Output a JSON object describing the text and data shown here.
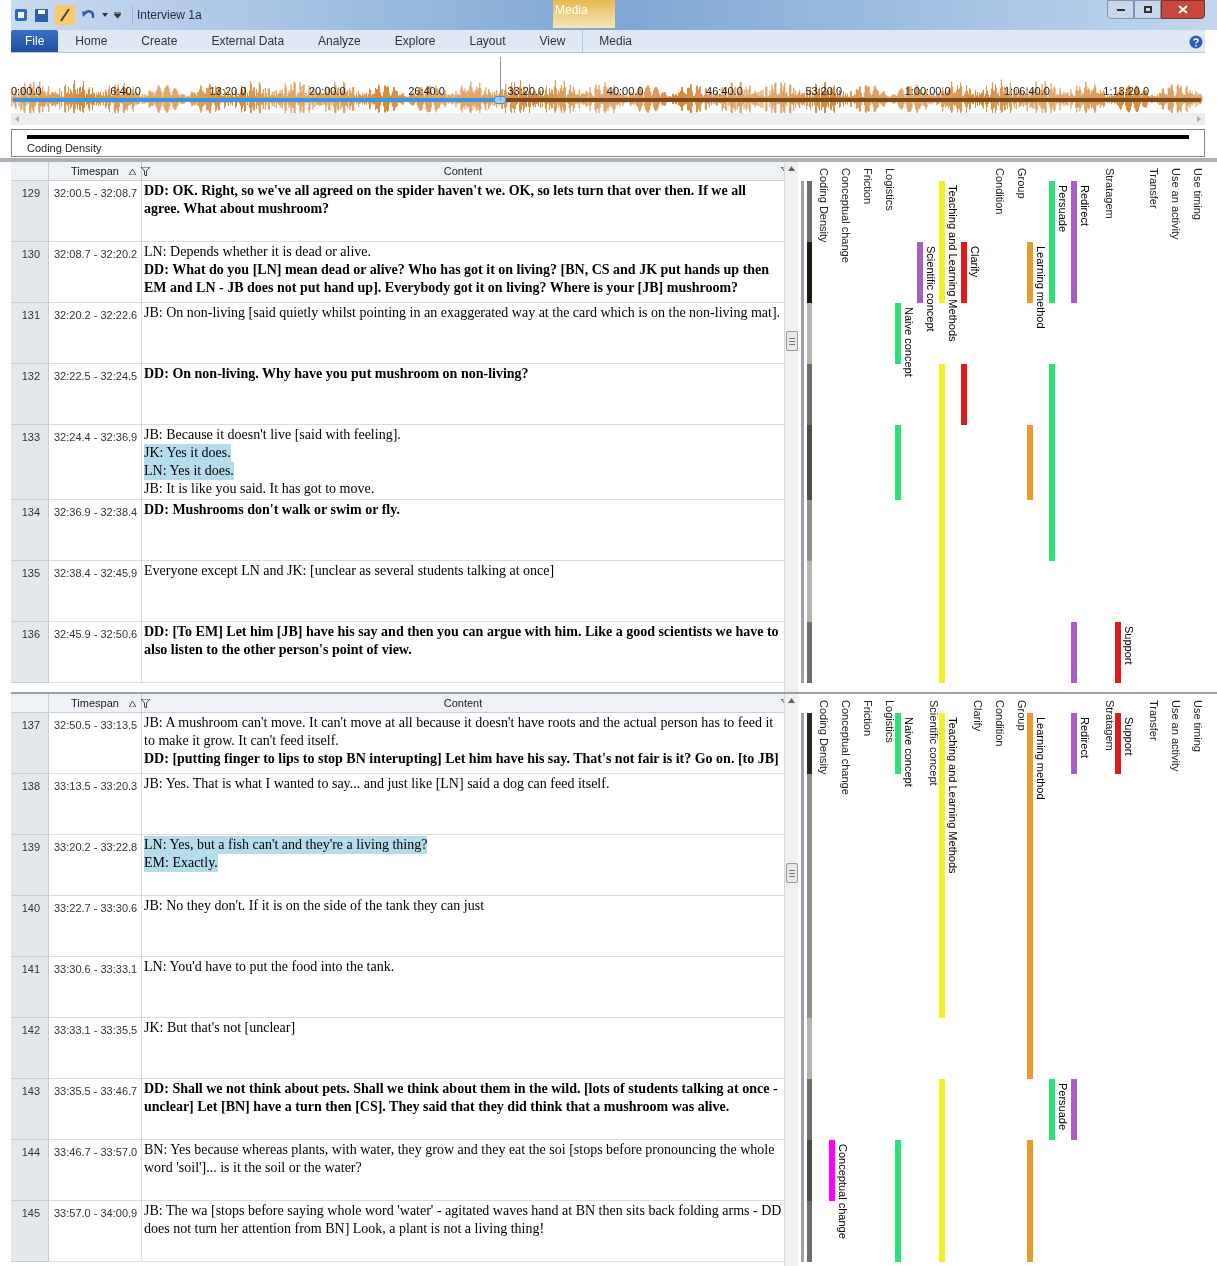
{
  "window": {
    "title": "Interview 1a",
    "context_group": "Media"
  },
  "ribbon_tabs": [
    {
      "label": "File",
      "kind": "file"
    },
    {
      "label": "Home",
      "kind": "tab"
    },
    {
      "label": "Create",
      "kind": "tab"
    },
    {
      "label": "External Data",
      "kind": "tab"
    },
    {
      "label": "Analyze",
      "kind": "tab"
    },
    {
      "label": "Explore",
      "kind": "tab"
    },
    {
      "label": "Layout",
      "kind": "tab"
    },
    {
      "label": "View",
      "kind": "tab"
    },
    {
      "label": "Media",
      "kind": "context"
    }
  ],
  "media": {
    "level": 0.41,
    "time_labels": [
      "0:00.0",
      "6:40.0",
      "13:20.0",
      "20:00.0",
      "26:40.0",
      "33:20.0",
      "40:00.0",
      "46:40.0",
      "53:20.0",
      "1:00:00.0",
      "1:06:40.0",
      "1:13:20.0"
    ]
  },
  "coding_density_strip": {
    "label": "Coding Density"
  },
  "panes": [
    {
      "columns": {
        "timespan": "Timespan",
        "content": "Content"
      },
      "rows": [
        {
          "number": "129",
          "timespan": "32:00.5 - 32:08.7",
          "lines": [
            {
              "text": "DD: OK. Right, so we've all agreed on the spider haven't we. OK, so lets turn that over then. If we all agree. What about mushroom?",
              "bold": true,
              "highlighted": false
            }
          ]
        },
        {
          "number": "130",
          "timespan": "32:08.7 - 32:20.2",
          "lines": [
            {
              "text": "LN: Depends whether it is dead or alive.",
              "bold": false,
              "highlighted": false
            },
            {
              "text": "DD: What do you [LN] mean dead or alive? Who has got it on living? [BN, CS and JK put hands up then EM and LN - JB does not put hand up]. Everybody got it on living? Where is your [JB] mushroom?",
              "bold": true,
              "highlighted": false
            }
          ]
        },
        {
          "number": "131",
          "timespan": "32:20.2 - 32:22.6",
          "lines": [
            {
              "text": "JB: On non-living [said quietly whilst pointing in an exaggerated way at the card which is on the non-living mat].",
              "bold": false,
              "highlighted": false
            }
          ]
        },
        {
          "number": "132",
          "timespan": "32:22.5 - 32:24.5",
          "lines": [
            {
              "text": "DD: On non-living. Why have you put mushroom on non-living?",
              "bold": true,
              "highlighted": false
            }
          ]
        },
        {
          "number": "133",
          "timespan": "32:24.4 - 32:36.9",
          "lines": [
            {
              "text": "JB: Because it doesn't live [said with feeling].",
              "bold": false,
              "highlighted": false
            },
            {
              "text": "JK: Yes it does.",
              "bold": false,
              "highlighted": true
            },
            {
              "text": "LN: Yes it does.",
              "bold": false,
              "highlighted": true
            },
            {
              "text": "JB: It is like you said. It has got to move.",
              "bold": false,
              "highlighted": false
            }
          ]
        },
        {
          "number": "134",
          "timespan": "32:36.9 - 32:38.4",
          "lines": [
            {
              "text": "DD: Mushrooms don't walk or swim or fly.",
              "bold": true,
              "highlighted": false
            }
          ]
        },
        {
          "number": "135",
          "timespan": "32:38.4 - 32:45.9",
          "lines": [
            {
              "text": "Everyone except LN and JK: [unclear as several students talking at once]",
              "bold": false,
              "highlighted": false
            }
          ]
        },
        {
          "number": "136",
          "timespan": "32:45.9 - 32:50.6",
          "lines": [
            {
              "text": "DD: [To EM] Let him [JB] have his say and then you can argue with him. Like a good scientists we have to also listen to the other person's point of view.",
              "bold": true,
              "highlighted": false
            }
          ]
        }
      ],
      "stripes": [
        {
          "kind": "density",
          "name": "Coding Density"
        },
        {
          "kind": "code",
          "name": "Conceptual change"
        },
        {
          "kind": "code",
          "name": "Friction"
        },
        {
          "kind": "code",
          "name": "Logistics"
        },
        {
          "kind": "code",
          "bar_label": "Naive concept",
          "color": "#2ee07a",
          "coded": [
            false,
            false,
            true,
            false,
            true,
            false,
            false,
            false
          ]
        },
        {
          "kind": "code",
          "bar_label": "Scientific concept",
          "color": "#a85ec4",
          "coded": [
            false,
            true,
            false,
            false,
            false,
            false,
            false,
            false
          ]
        },
        {
          "kind": "code",
          "bar_label": "Teaching and Learning Methods",
          "color": "#f2f222",
          "coded": [
            true,
            true,
            false,
            true,
            true,
            true,
            true,
            true
          ]
        },
        {
          "kind": "code",
          "bar_label": "Clarify",
          "color": "#e01a1a",
          "coded": [
            false,
            true,
            false,
            true,
            false,
            false,
            false,
            false
          ]
        },
        {
          "kind": "code",
          "name": "Condition"
        },
        {
          "kind": "code",
          "name": "Group"
        },
        {
          "kind": "code",
          "bar_label": "Learning method",
          "color": "#e89a2c",
          "coded": [
            false,
            true,
            false,
            false,
            true,
            false,
            false,
            false
          ]
        },
        {
          "kind": "code",
          "bar_label": "Persuade",
          "color": "#2ee07a",
          "coded": [
            true,
            true,
            false,
            true,
            true,
            true,
            false,
            false
          ]
        },
        {
          "kind": "code",
          "bar_label": "Redirect",
          "color": "#a85ec4",
          "coded": [
            true,
            true,
            false,
            false,
            false,
            false,
            false,
            true
          ]
        },
        {
          "kind": "code",
          "name": "Stratagem"
        },
        {
          "kind": "code",
          "bar_label": "Support",
          "color": "#e01a1a",
          "coded": [
            false,
            false,
            false,
            false,
            false,
            false,
            false,
            true
          ]
        },
        {
          "kind": "code",
          "name": "Transfer"
        },
        {
          "kind": "code",
          "name": "Use an activity"
        },
        {
          "kind": "code",
          "name": "Use timing"
        }
      ]
    },
    {
      "columns": {
        "timespan": "Timespan",
        "content": "Content"
      },
      "rows": [
        {
          "number": "137",
          "timespan": "32:50.5 - 33:13.5",
          "lines": [
            {
              "text": "JB: A mushroom can't move. It can't move at all because it doesn't have roots and the actual person has to feed it to make it grow. It can't feed itself.",
              "bold": false,
              "highlighted": false
            },
            {
              "text": "DD: [putting finger to lips to stop BN interupting] Let him have his say. That's not fair is it? Go on. [to JB]",
              "bold": true,
              "highlighted": false
            }
          ]
        },
        {
          "number": "138",
          "timespan": "33:13.5 - 33:20.3",
          "lines": [
            {
              "text": "JB: Yes. That is what I wanted to say... and just like [LN] said a dog can feed itself.",
              "bold": false,
              "highlighted": false
            }
          ]
        },
        {
          "number": "139",
          "timespan": "33:20.2 - 33:22.8",
          "lines": [
            {
              "text": "LN: Yes, but a fish can't and they're a living thing?",
              "bold": false,
              "highlighted": true
            },
            {
              "text": "EM: Exactly.",
              "bold": false,
              "highlighted": true
            }
          ]
        },
        {
          "number": "140",
          "timespan": "33:22.7 - 33:30.6",
          "lines": [
            {
              "text": "JB: No they don't. If it is on the side of the tank they can just",
              "bold": false,
              "highlighted": false
            }
          ]
        },
        {
          "number": "141",
          "timespan": "33:30.6 - 33:33.1",
          "lines": [
            {
              "text": "LN: You'd have to put the food into the tank.",
              "bold": false,
              "highlighted": false
            }
          ]
        },
        {
          "number": "142",
          "timespan": "33:33.1 - 33:35.5",
          "lines": [
            {
              "text": "JK: But that's not [unclear]",
              "bold": false,
              "highlighted": false
            }
          ]
        },
        {
          "number": "143",
          "timespan": "33:35.5 - 33:46.7",
          "lines": [
            {
              "text": "DD: Shall we not think about pets. Shall we think about them in the wild. [lots of students talking at once - unclear] Let [BN] have a turn then [CS]. They said that they did think that a mushroom was alive.",
              "bold": true,
              "highlighted": false
            }
          ]
        },
        {
          "number": "144",
          "timespan": "33:46.7 - 33:57.0",
          "lines": [
            {
              "text": "BN: Yes because whereas plants, with water, they grow and they eat the soi [stops before pronouncing the whole word 'soil']... is it the soil or the water?",
              "bold": false,
              "highlighted": false
            }
          ]
        },
        {
          "number": "145",
          "timespan": "33:57.0 - 34:00.9",
          "lines": [
            {
              "text": "JB: The wa [stops before saying whole word 'water' - agitated waves hand at BN then sits back folding arms - DD does not turn her attention from BN] Look, a plant is not a living thing!",
              "bold": false,
              "highlighted": false
            }
          ]
        }
      ],
      "stripes": [
        {
          "kind": "density",
          "name": "Coding Density"
        },
        {
          "kind": "code",
          "name": "Conceptual change",
          "bar_label": "Conceptual change",
          "color": "#ff00ff",
          "coded": [
            false,
            false,
            false,
            false,
            false,
            false,
            false,
            true,
            false
          ]
        },
        {
          "kind": "code",
          "name": "Friction"
        },
        {
          "kind": "code",
          "name": "Logistics"
        },
        {
          "kind": "code",
          "bar_label": "Naive concept",
          "color": "#2ee07a",
          "coded": [
            true,
            false,
            false,
            false,
            false,
            false,
            false,
            true,
            true
          ]
        },
        {
          "kind": "code",
          "name": "Scientific concept"
        },
        {
          "kind": "code",
          "bar_label": "Teaching and Learning Methods",
          "color": "#f2f222",
          "coded": [
            true,
            true,
            true,
            true,
            true,
            false,
            true,
            true,
            true
          ]
        },
        {
          "kind": "code",
          "name": "Clarify"
        },
        {
          "kind": "code",
          "name": "Condition"
        },
        {
          "kind": "code",
          "name": "Group"
        },
        {
          "kind": "code",
          "bar_label": "Learning method",
          "color": "#e89a2c",
          "coded": [
            true,
            true,
            true,
            true,
            true,
            true,
            false,
            true,
            true
          ]
        },
        {
          "kind": "code",
          "bar_label": "Persuade",
          "color": "#2ee07a",
          "coded": [
            false,
            false,
            false,
            false,
            false,
            false,
            true,
            false,
            false
          ]
        },
        {
          "kind": "code",
          "bar_label": "Redirect",
          "color": "#a85ec4",
          "coded": [
            true,
            false,
            false,
            false,
            false,
            false,
            true,
            false,
            false
          ]
        },
        {
          "kind": "code",
          "name": "Stratagem"
        },
        {
          "kind": "code",
          "bar_label": "Support",
          "color": "#e01a1a",
          "coded": [
            true,
            false,
            false,
            false,
            false,
            false,
            false,
            false,
            false
          ]
        },
        {
          "kind": "code",
          "name": "Transfer"
        },
        {
          "kind": "code",
          "name": "Use an activity"
        },
        {
          "kind": "code",
          "name": "Use timing"
        }
      ]
    }
  ]
}
